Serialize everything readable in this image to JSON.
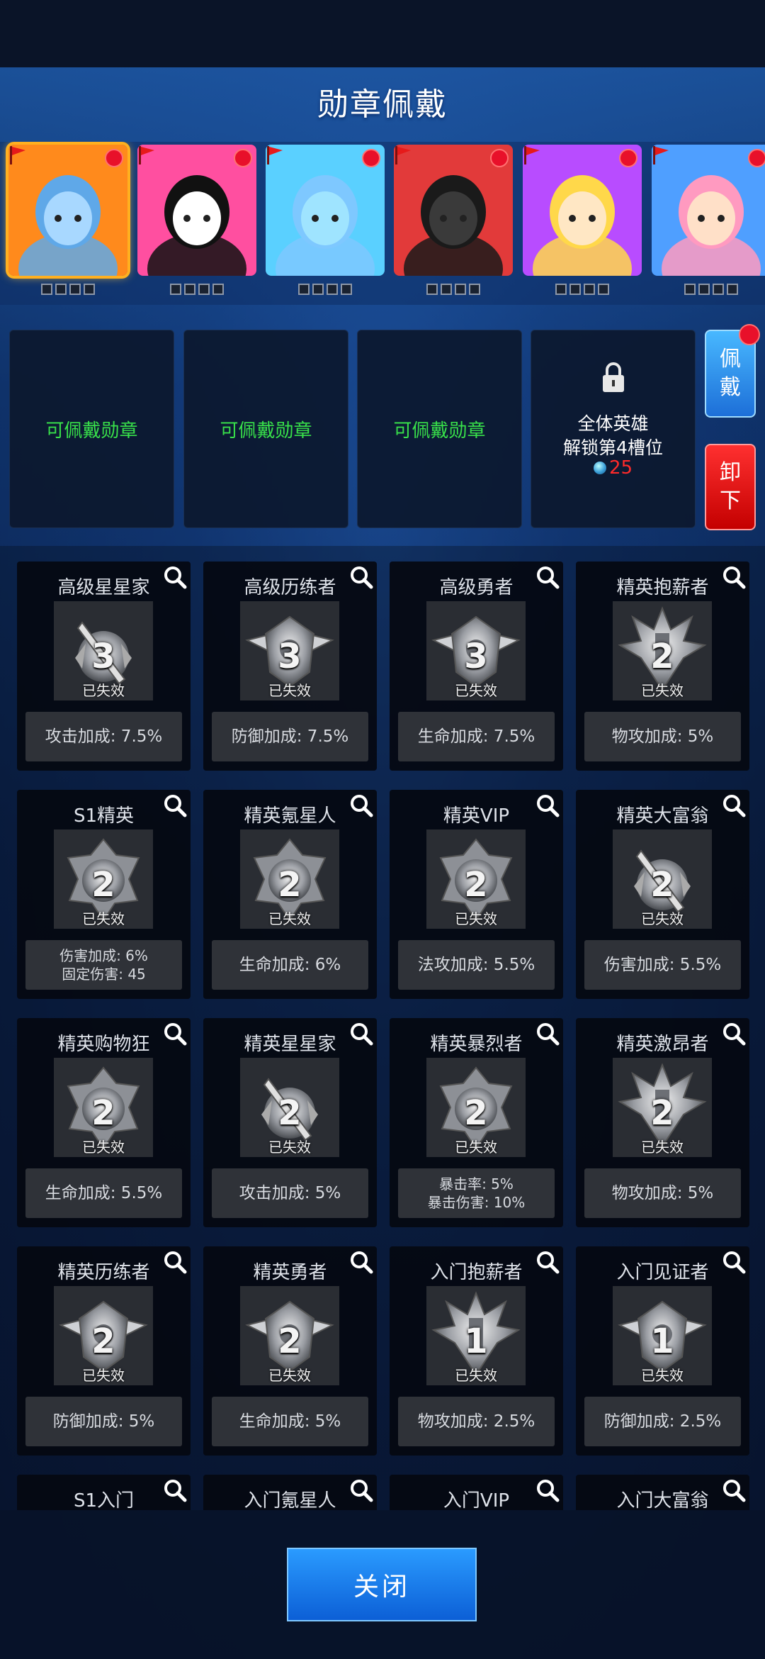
{
  "header": {
    "title": "勋章佩戴"
  },
  "heroes": [
    {
      "name": "hero-blue-hair-girl",
      "selected": true,
      "bg": "#ff8a1c",
      "skin": "#a8d8ff",
      "hair": "#5fa8e8"
    },
    {
      "name": "hero-black-cat-cube",
      "selected": false,
      "bg": "#ff4fa0",
      "skin": "#ffffff",
      "hair": "#111111"
    },
    {
      "name": "hero-blue-narwhal",
      "selected": false,
      "bg": "#5ad0ff",
      "skin": "#9fe4ff",
      "hair": "#7ec8ff"
    },
    {
      "name": "hero-dark-knight",
      "selected": false,
      "bg": "#e23a3a",
      "skin": "#3a3a3a",
      "hair": "#1a1a1a"
    },
    {
      "name": "hero-blonde-elf",
      "selected": false,
      "bg": "#b84cff",
      "skin": "#ffe7c4",
      "hair": "#ffd84a"
    },
    {
      "name": "hero-pink-detective",
      "selected": false,
      "bg": "#4f9fff",
      "skin": "#ffe0c8",
      "hair": "#ff9ac0"
    }
  ],
  "slots": [
    {
      "label": "可佩戴勋章"
    },
    {
      "label": "可佩戴勋章"
    },
    {
      "label": "可佩戴勋章"
    },
    {
      "line1": "全体英雄",
      "line2": "解锁第4槽位",
      "cost": "25"
    }
  ],
  "side_buttons": {
    "wear": "佩戴",
    "remove": "卸下"
  },
  "badges": [
    {
      "name": "高级星星家",
      "tier": "3",
      "status": "已失效",
      "stats": [
        "攻击加成: 7.5%"
      ],
      "icon": "sword"
    },
    {
      "name": "高级历练者",
      "tier": "3",
      "status": "已失效",
      "stats": [
        "防御加成: 7.5%"
      ],
      "icon": "wings"
    },
    {
      "name": "高级勇者",
      "tier": "3",
      "status": "已失效",
      "stats": [
        "生命加成: 7.5%"
      ],
      "icon": "wings"
    },
    {
      "name": "精英抱薪者",
      "tier": "2",
      "status": "已失效",
      "stats": [
        "物攻加成: 5%"
      ],
      "icon": "spikes"
    },
    {
      "name": "S1精英",
      "tier": "2",
      "status": "已失效",
      "stats": [
        "伤害加成: 6%",
        "固定伤害: 45"
      ],
      "icon": "orb"
    },
    {
      "name": "精英氪星人",
      "tier": "2",
      "status": "已失效",
      "stats": [
        "生命加成: 6%"
      ],
      "icon": "orb"
    },
    {
      "name": "精英VIP",
      "tier": "2",
      "status": "已失效",
      "stats": [
        "法攻加成: 5.5%"
      ],
      "icon": "orb"
    },
    {
      "name": "精英大富翁",
      "tier": "2",
      "status": "已失效",
      "stats": [
        "伤害加成: 5.5%"
      ],
      "icon": "sword"
    },
    {
      "name": "精英购物狂",
      "tier": "2",
      "status": "已失效",
      "stats": [
        "生命加成: 5.5%"
      ],
      "icon": "orb"
    },
    {
      "name": "精英星星家",
      "tier": "2",
      "status": "已失效",
      "stats": [
        "攻击加成: 5%"
      ],
      "icon": "sword"
    },
    {
      "name": "精英暴烈者",
      "tier": "2",
      "status": "已失效",
      "stats": [
        "暴击率: 5%",
        "暴击伤害: 10%"
      ],
      "icon": "orb"
    },
    {
      "name": "精英激昂者",
      "tier": "2",
      "status": "已失效",
      "stats": [
        "物攻加成: 5%"
      ],
      "icon": "spikes"
    },
    {
      "name": "精英历练者",
      "tier": "2",
      "status": "已失效",
      "stats": [
        "防御加成: 5%"
      ],
      "icon": "wings"
    },
    {
      "name": "精英勇者",
      "tier": "2",
      "status": "已失效",
      "stats": [
        "生命加成: 5%"
      ],
      "icon": "wings"
    },
    {
      "name": "入门抱薪者",
      "tier": "1",
      "status": "已失效",
      "stats": [
        "物攻加成: 2.5%"
      ],
      "icon": "spikes"
    },
    {
      "name": "入门见证者",
      "tier": "1",
      "status": "已失效",
      "stats": [
        "防御加成: 2.5%"
      ],
      "icon": "wings"
    },
    {
      "name": "S1入门",
      "tier": "",
      "status": "",
      "stats": [],
      "icon": "none"
    },
    {
      "name": "入门氪星人",
      "tier": "",
      "status": "",
      "stats": [],
      "icon": "none"
    },
    {
      "name": "入门VIP",
      "tier": "",
      "status": "",
      "stats": [],
      "icon": "none"
    },
    {
      "name": "入门大富翁",
      "tier": "",
      "status": "",
      "stats": [],
      "icon": "none"
    }
  ],
  "footer": {
    "close_label": "关闭"
  },
  "colors": {
    "accent_blue": "#1d7fe8",
    "available_green": "#38e04a",
    "cost_red": "#ff2a2a",
    "notify_red": "#e8102a"
  }
}
